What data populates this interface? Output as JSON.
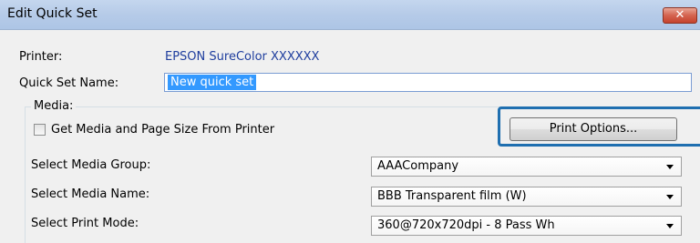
{
  "window": {
    "title": "Edit Quick Set",
    "close_icon": "close-icon"
  },
  "form": {
    "printer_label": "Printer:",
    "printer_value": "EPSON SureColor XXXXXX",
    "quick_set_name_label": "Quick Set Name:",
    "quick_set_name_value": "New quick set"
  },
  "media": {
    "group_label": "Media:",
    "get_media_checkbox_label": "Get Media and Page Size From Printer",
    "get_media_checked": false,
    "print_options_button": "Print Options...",
    "media_group_label": "Select Media Group:",
    "media_group_value": "AAACompany",
    "media_name_label": "Select Media Name:",
    "media_name_value": "BBB Transparent film (W)",
    "print_mode_label": "Select Print Mode:",
    "print_mode_value": "360@720x720dpi - 8 Pass Wh"
  },
  "colors": {
    "highlight": "#1f6fb0",
    "printer_value": "#1f3e9e",
    "selection": "#3399ff"
  }
}
